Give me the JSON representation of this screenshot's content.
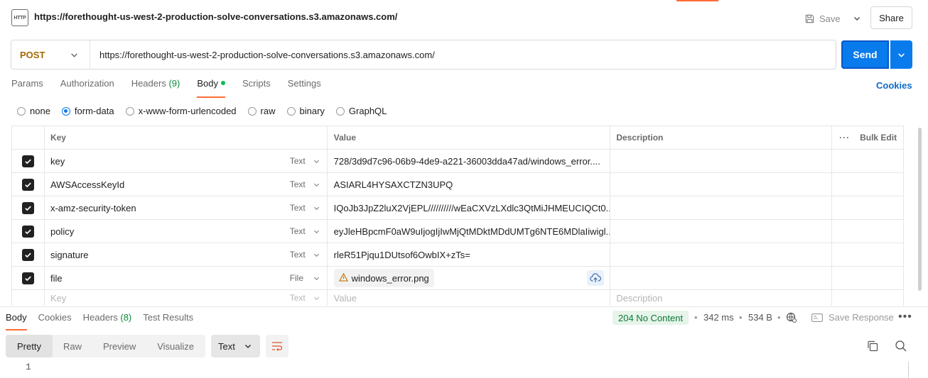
{
  "header": {
    "icon_label": "HTTP",
    "title": "https://forethought-us-west-2-production-solve-conversations.s3.amazonaws.com/",
    "save_label": "Save",
    "share_label": "Share"
  },
  "request": {
    "method": "POST",
    "url": "https://forethought-us-west-2-production-solve-conversations.s3.amazonaws.com/",
    "send_label": "Send"
  },
  "tabs": {
    "params": "Params",
    "authorization": "Authorization",
    "headers": "Headers",
    "headers_count": "(9)",
    "body": "Body",
    "scripts": "Scripts",
    "settings": "Settings",
    "cookies": "Cookies"
  },
  "body_types": {
    "none": "none",
    "form_data": "form-data",
    "urlencoded": "x-www-form-urlencoded",
    "raw": "raw",
    "binary": "binary",
    "graphql": "GraphQL",
    "selected": "form-data"
  },
  "table": {
    "col_key": "Key",
    "col_value": "Value",
    "col_description": "Description",
    "bulk_edit": "Bulk Edit",
    "rows": [
      {
        "key": "key",
        "type": "Text",
        "value": "728/3d9d7c96-06b9-4de9-a221-36003dda47ad/windows_error...."
      },
      {
        "key": "AWSAccessKeyId",
        "type": "Text",
        "value": "ASIARL4HYSAXCTZN3UPQ"
      },
      {
        "key": "x-amz-security-token",
        "type": "Text",
        "value": "IQoJb3JpZ2luX2VjEPL//////////wEaCXVzLXdlc3QtMiJHMEUCIQCt0..."
      },
      {
        "key": "policy",
        "type": "Text",
        "value": "eyJleHBpcmF0aW9uIjogIjIwMjQtMDktMDdUMTg6NTE6MDlaIiwigl..."
      },
      {
        "key": "signature",
        "type": "Text",
        "value": "rleR51Pjqu1DUtsof6OwbIX+zTs="
      },
      {
        "key": "file",
        "type": "File",
        "value": "windows_error.png"
      }
    ],
    "placeholder_key": "Key",
    "placeholder_type": "Text",
    "placeholder_value": "Value",
    "placeholder_description": "Description"
  },
  "response": {
    "tabs": {
      "body": "Body",
      "cookies": "Cookies",
      "headers": "Headers",
      "headers_count": "(8)",
      "test_results": "Test Results"
    },
    "status": "204 No Content",
    "time": "342 ms",
    "size": "534 B",
    "save_response": "Save Response",
    "views": [
      "Pretty",
      "Raw",
      "Preview",
      "Visualize"
    ],
    "active_view": "Pretty",
    "format": "Text",
    "line_number": "1"
  },
  "colors": {
    "accent": "#ff6c37",
    "send": "#097bed",
    "method": "#a46a00",
    "success": "#0a7a34"
  }
}
